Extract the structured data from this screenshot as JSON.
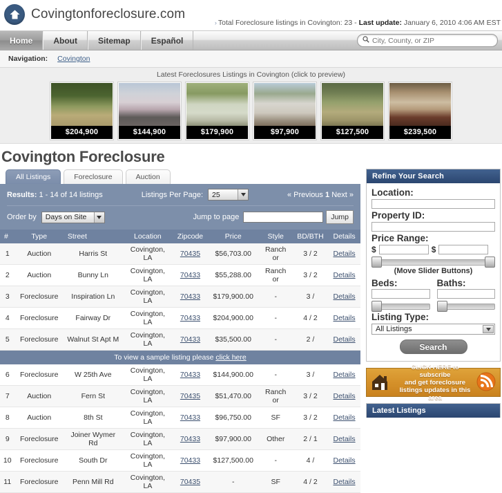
{
  "header": {
    "site_title": "Covingtonforeclosure.com",
    "logo_icon": "house-circle-icon",
    "note_prefix": "Total Foreclosure listings in Covington: 23 - ",
    "note_bold": "Last update:",
    "note_suffix": " January 6, 2010 4:06 AM EST"
  },
  "nav": {
    "items": [
      {
        "label": "Home",
        "active": true
      },
      {
        "label": "About",
        "active": false
      },
      {
        "label": "Sitemap",
        "active": false
      },
      {
        "label": "Español",
        "active": false
      }
    ],
    "search": {
      "icon": "search-icon",
      "value": "",
      "placeholder": "City, County, or ZIP"
    }
  },
  "breadcrumb": {
    "label": "Navigation:",
    "link": "Covington"
  },
  "gallery": {
    "caption": "Latest Foreclosures Listings in Covington (click to preview)",
    "items": [
      {
        "price": "$204,900"
      },
      {
        "price": "$144,900"
      },
      {
        "price": "$179,900"
      },
      {
        "price": "$97,900"
      },
      {
        "price": "$127,500"
      },
      {
        "price": "$239,500"
      }
    ]
  },
  "page_title": "Covington Foreclosure",
  "tabs": [
    {
      "label": "All Listings",
      "active": true
    },
    {
      "label": "Foreclosure",
      "active": false
    },
    {
      "label": "Auction",
      "active": false
    }
  ],
  "results_bar": {
    "results_label": "Results:",
    "results_text": " 1 - 14 of 14 listings",
    "per_page_label": "Listings Per Page:",
    "per_page_value": "25",
    "pager_prev": "« Previous",
    "pager_current": "1",
    "pager_next": "Next »",
    "order_by_label": "Order by",
    "order_by_value": "Days on Site",
    "jump_label": "Jump to page",
    "jump_value": "",
    "jump_button": "Jump"
  },
  "table": {
    "columns": [
      "#",
      "Type",
      "Street",
      "Location",
      "Zipcode",
      "Price",
      "Style",
      "BD/BTH",
      "Details"
    ],
    "sample_row_text": "To view a sample listing please ",
    "sample_row_link": "click here",
    "sample_row_after": 5,
    "rows": [
      {
        "num": "1",
        "type": "Auction",
        "street": "Harris St",
        "location": "Covington, LA",
        "zip": "70435",
        "price": "$56,703.00",
        "style": "Ranch or",
        "bdbth": "3 / 2",
        "details": "Details"
      },
      {
        "num": "2",
        "type": "Auction",
        "street": "Bunny Ln",
        "location": "Covington, LA",
        "zip": "70433",
        "price": "$55,288.00",
        "style": "Ranch or",
        "bdbth": "3 / 2",
        "details": "Details"
      },
      {
        "num": "3",
        "type": "Foreclosure",
        "street": "Inspiration Ln",
        "location": "Covington, LA",
        "zip": "70433",
        "price": "$179,900.00",
        "style": "-",
        "bdbth": "3 /",
        "details": "Details"
      },
      {
        "num": "4",
        "type": "Foreclosure",
        "street": "Fairway Dr",
        "location": "Covington, LA",
        "zip": "70433",
        "price": "$204,900.00",
        "style": "-",
        "bdbth": "4 / 2",
        "details": "Details"
      },
      {
        "num": "5",
        "type": "Foreclosure",
        "street": "Walnut St Apt M",
        "location": "Covington, LA",
        "zip": "70433",
        "price": "$35,500.00",
        "style": "-",
        "bdbth": "2 /",
        "details": "Details"
      },
      {
        "num": "6",
        "type": "Foreclosure",
        "street": "W 25th Ave",
        "location": "Covington, LA",
        "zip": "70433",
        "price": "$144,900.00",
        "style": "-",
        "bdbth": "3 /",
        "details": "Details"
      },
      {
        "num": "7",
        "type": "Auction",
        "street": "Fern St",
        "location": "Covington, LA",
        "zip": "70435",
        "price": "$51,470.00",
        "style": "Ranch or",
        "bdbth": "3 / 2",
        "details": "Details"
      },
      {
        "num": "8",
        "type": "Auction",
        "street": "8th St",
        "location": "Covington, LA",
        "zip": "70433",
        "price": "$96,750.00",
        "style": "SF",
        "bdbth": "3 / 2",
        "details": "Details"
      },
      {
        "num": "9",
        "type": "Foreclosure",
        "street": "Joiner Wymer Rd",
        "location": "Covington, LA",
        "zip": "70433",
        "price": "$97,900.00",
        "style": "Other",
        "bdbth": "2 / 1",
        "details": "Details"
      },
      {
        "num": "10",
        "type": "Foreclosure",
        "street": "South Dr",
        "location": "Covington, LA",
        "zip": "70433",
        "price": "$127,500.00",
        "style": "-",
        "bdbth": "4 /",
        "details": "Details"
      },
      {
        "num": "11",
        "type": "Foreclosure",
        "street": "Penn Mill Rd",
        "location": "Covington, LA",
        "zip": "70435",
        "price": "-",
        "style": "SF",
        "bdbth": "4 / 2",
        "details": "Details"
      }
    ]
  },
  "sidebar": {
    "refine_title": "Refine Your Search",
    "location_label": "Location:",
    "location_value": "",
    "property_id_label": "Property ID:",
    "property_id_value": "",
    "price_range_label": "Price Range:",
    "price_min": "",
    "price_max": "",
    "dollar": "$",
    "slider_hint": "(Move Slider Buttons)",
    "beds_label": "Beds:",
    "beds_value": "",
    "baths_label": "Baths:",
    "baths_value": "",
    "listing_type_label": "Listing Type:",
    "listing_type_value": "All Listings",
    "search_button": "Search",
    "rss_banner": {
      "line1": "CLICK HERE to subscribe",
      "line2": "and get foreclosure",
      "line3": "listings updates in this area",
      "house_icon": "house-icon",
      "rss_icon": "rss-icon"
    },
    "latest_listings_title": "Latest Listings"
  },
  "colors": {
    "brand_blue": "#2b4670",
    "panel_blue": "#7d8faa",
    "table_header": "#6f82a0",
    "rss_orange": "#d5912a",
    "link": "#3b5d87"
  }
}
